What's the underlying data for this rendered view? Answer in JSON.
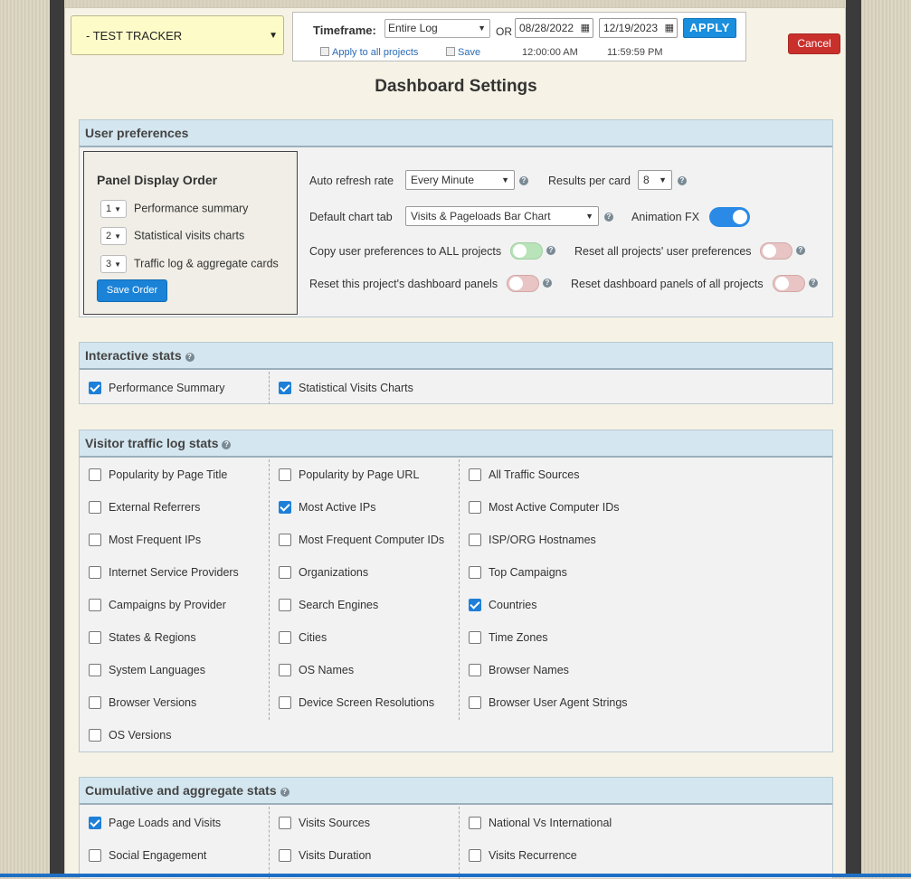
{
  "header": {
    "tracker": "- TEST TRACKER",
    "timeframe_label": "Timeframe:",
    "timeframe_value": "Entire Log",
    "or_label": "OR",
    "start_date": "08/28/2022",
    "end_date": "12/19/2023",
    "apply_label": "APPLY",
    "apply_all_label": "Apply to all projects",
    "save_label": "Save",
    "start_time": "12:00:00 AM",
    "end_time": "11:59:59 PM",
    "cancel_label": "Cancel"
  },
  "page_title": "Dashboard Settings",
  "user_prefs": {
    "title": "User preferences",
    "panel_order": {
      "title": "Panel Display Order",
      "rows": [
        {
          "num": "1",
          "label": "Performance summary"
        },
        {
          "num": "2",
          "label": "Statistical visits charts"
        },
        {
          "num": "3",
          "label": "Traffic log & aggregate cards"
        }
      ],
      "save_label": "Save Order"
    },
    "auto_refresh_label": "Auto refresh rate",
    "auto_refresh_value": "Every Minute",
    "results_label": "Results per card",
    "results_value": "8",
    "chart_tab_label": "Default chart tab",
    "chart_tab_value": "Visits & Pageloads Bar Chart",
    "animation_label": "Animation FX",
    "copy_prefs_label": "Copy user preferences to ALL projects",
    "reset_all_prefs_label": "Reset all projects' user preferences",
    "reset_panels_label": "Reset this project's dashboard panels",
    "reset_all_panels_label": "Reset dashboard panels of all projects"
  },
  "interactive": {
    "title": "Interactive stats",
    "items": [
      {
        "label": "Performance Summary",
        "checked": true
      },
      {
        "label": "Statistical Visits Charts",
        "checked": true
      }
    ]
  },
  "traffic": {
    "title": "Visitor traffic log stats",
    "columns": [
      [
        {
          "label": "Popularity by Page Title",
          "checked": false
        },
        {
          "label": "External Referrers",
          "checked": false
        },
        {
          "label": "Most Frequent IPs",
          "checked": false
        },
        {
          "label": "Internet Service Providers",
          "checked": false
        },
        {
          "label": "Campaigns by Provider",
          "checked": false
        },
        {
          "label": "States & Regions",
          "checked": false
        },
        {
          "label": "System Languages",
          "checked": false
        },
        {
          "label": "Browser Versions",
          "checked": false
        },
        {
          "label": "OS Versions",
          "checked": false
        }
      ],
      [
        {
          "label": "Popularity by Page URL",
          "checked": false
        },
        {
          "label": "Most Active IPs",
          "checked": true
        },
        {
          "label": "Most Frequent Computer IDs",
          "checked": false
        },
        {
          "label": "Organizations",
          "checked": false
        },
        {
          "label": "Search Engines",
          "checked": false
        },
        {
          "label": "Cities",
          "checked": false
        },
        {
          "label": "OS Names",
          "checked": false
        },
        {
          "label": "Device Screen Resolutions",
          "checked": false
        }
      ],
      [
        {
          "label": "All Traffic Sources",
          "checked": false
        },
        {
          "label": "Most Active Computer IDs",
          "checked": false
        },
        {
          "label": "ISP/ORG Hostnames",
          "checked": false
        },
        {
          "label": "Top Campaigns",
          "checked": false
        },
        {
          "label": "Countries",
          "checked": true
        },
        {
          "label": "Time Zones",
          "checked": false
        },
        {
          "label": "Browser Names",
          "checked": false
        },
        {
          "label": "Browser User Agent Strings",
          "checked": false
        }
      ]
    ]
  },
  "cumulative": {
    "title": "Cumulative and aggregate stats",
    "columns": [
      [
        {
          "label": "Page Loads and Visits",
          "checked": true
        },
        {
          "label": "Social Engagement",
          "checked": false
        }
      ],
      [
        {
          "label": "Visits Sources",
          "checked": false
        },
        {
          "label": "Visits Duration",
          "checked": false
        }
      ],
      [
        {
          "label": "National Vs International",
          "checked": false
        },
        {
          "label": "Visits Recurrence",
          "checked": false
        }
      ]
    ]
  }
}
